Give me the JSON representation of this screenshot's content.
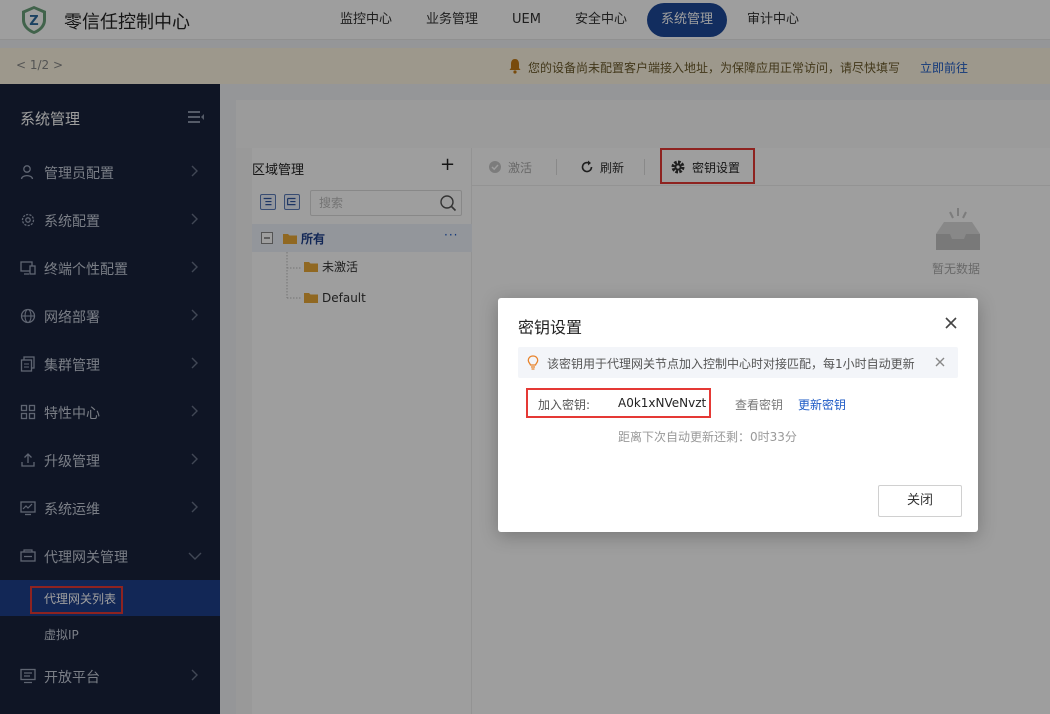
{
  "app": {
    "title": "零信任控制中心"
  },
  "nav": {
    "items": [
      {
        "label": "监控中心",
        "active": false
      },
      {
        "label": "业务管理",
        "active": false
      },
      {
        "label": "UEM",
        "active": false
      },
      {
        "label": "安全中心",
        "active": false
      },
      {
        "label": "系统管理",
        "active": true
      },
      {
        "label": "审计中心",
        "active": false
      }
    ]
  },
  "notice": {
    "pager": "< 1/2 >",
    "text": "您的设备尚未配置客户端接入地址，为保障应用正常访问，请尽快填写",
    "link": "立即前往"
  },
  "sidebar": {
    "title": "系统管理",
    "items": [
      {
        "label": "管理员配置",
        "icon": "user-icon"
      },
      {
        "label": "系统配置",
        "icon": "gear-icon"
      },
      {
        "label": "终端个性配置",
        "icon": "monitor-icon"
      },
      {
        "label": "网络部署",
        "icon": "globe-icon"
      },
      {
        "label": "集群管理",
        "icon": "cluster-icon"
      },
      {
        "label": "特性中心",
        "icon": "grid-icon"
      },
      {
        "label": "升级管理",
        "icon": "upload-icon"
      },
      {
        "label": "系统运维",
        "icon": "chart-icon"
      },
      {
        "label": "代理网关管理",
        "icon": "gateway-icon"
      }
    ],
    "subitems": [
      {
        "label": "代理网关列表",
        "active": true
      },
      {
        "label": "虚拟IP",
        "active": false
      }
    ],
    "bottom_item": {
      "label": "开放平台",
      "icon": "platform-icon"
    }
  },
  "tree": {
    "title": "区域管理",
    "add": "+",
    "search_placeholder": "搜索",
    "root": "所有",
    "more": "···",
    "children": [
      "未激活",
      "Default"
    ]
  },
  "toolbar": {
    "activate": "激活",
    "refresh": "刷新",
    "key_settings": "密钥设置"
  },
  "empty": {
    "text": "暂无数据"
  },
  "modal": {
    "title": "密钥设置",
    "tip": "该密钥用于代理网关节点加入控制中心时对接匹配，每1小时自动更新",
    "key_label": "加入密钥:",
    "key_value": "A0k1xNVeNvzt",
    "view_key": "查看密钥",
    "update_key": "更新密钥",
    "countdown": "距离下次自动更新还剩：0时33分",
    "close_button": "关闭"
  },
  "colors": {
    "accent": "#1e4a9a",
    "sidebar_bg": "#19233d",
    "highlight": "#e53935",
    "link": "#1e5bc6"
  }
}
